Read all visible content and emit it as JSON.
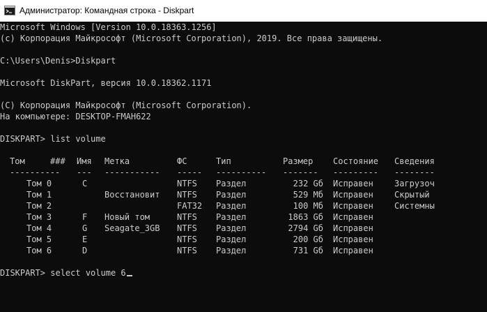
{
  "window": {
    "title": "Администратор: Командная строка - Diskpart",
    "icon": "cmd-icon"
  },
  "console": {
    "lines": [
      "Microsoft Windows [Version 10.0.18363.1256]",
      "(с) Корпорация Майкрософт (Microsoft Corporation), 2019. Все права защищены.",
      "",
      "C:\\Users\\Denis>Diskpart",
      "",
      "Microsoft DiskPart, версия 10.0.18362.1171",
      "",
      "(C) Корпорация Майкрософт (Microsoft Corporation).",
      "На компьютере: DESKTOP-FMAH622",
      "",
      "DISKPART> list volume"
    ],
    "table": {
      "headers": [
        "Том",
        "###",
        "Имя",
        "Метка",
        "ФС",
        "Тип",
        "Размер",
        "Состояние",
        "Сведения"
      ],
      "separators": [
        "----------",
        "---",
        "-----------",
        "-----",
        "----------",
        "-------",
        "---------",
        "--------"
      ],
      "rows": [
        {
          "vol": "Том 0",
          "ltr": "C",
          "label": "",
          "fs": "NTFS",
          "type": "Раздел",
          "size": "232 Gб",
          "status": "Исправен",
          "info": "Загрузоч"
        },
        {
          "vol": "Том 1",
          "ltr": "",
          "label": "Восстановит",
          "fs": "NTFS",
          "type": "Раздел",
          "size": "529 Mб",
          "status": "Исправен",
          "info": "Скрытый"
        },
        {
          "vol": "Том 2",
          "ltr": "",
          "label": "",
          "fs": "FAT32",
          "type": "Раздел",
          "size": "100 Mб",
          "status": "Исправен",
          "info": "Системны"
        },
        {
          "vol": "Том 3",
          "ltr": "F",
          "label": "Новый том",
          "fs": "NTFS",
          "type": "Раздел",
          "size": "1863 Gб",
          "status": "Исправен",
          "info": ""
        },
        {
          "vol": "Том 4",
          "ltr": "G",
          "label": "Seagate_3GB",
          "fs": "NTFS",
          "type": "Раздел",
          "size": "2794 Gб",
          "status": "Исправен",
          "info": ""
        },
        {
          "vol": "Том 5",
          "ltr": "E",
          "label": "",
          "fs": "NTFS",
          "type": "Раздел",
          "size": "200 Gб",
          "status": "Исправен",
          "info": ""
        },
        {
          "vol": "Том 6",
          "ltr": "D",
          "label": "",
          "fs": "NTFS",
          "type": "Раздел",
          "size": "731 Gб",
          "status": "Исправен",
          "info": ""
        }
      ]
    },
    "prompt": "DISKPART> select volume 6"
  },
  "colors": {
    "background": "#0c0c0c",
    "text": "#cccccc",
    "titlebar": "#ffffff"
  }
}
